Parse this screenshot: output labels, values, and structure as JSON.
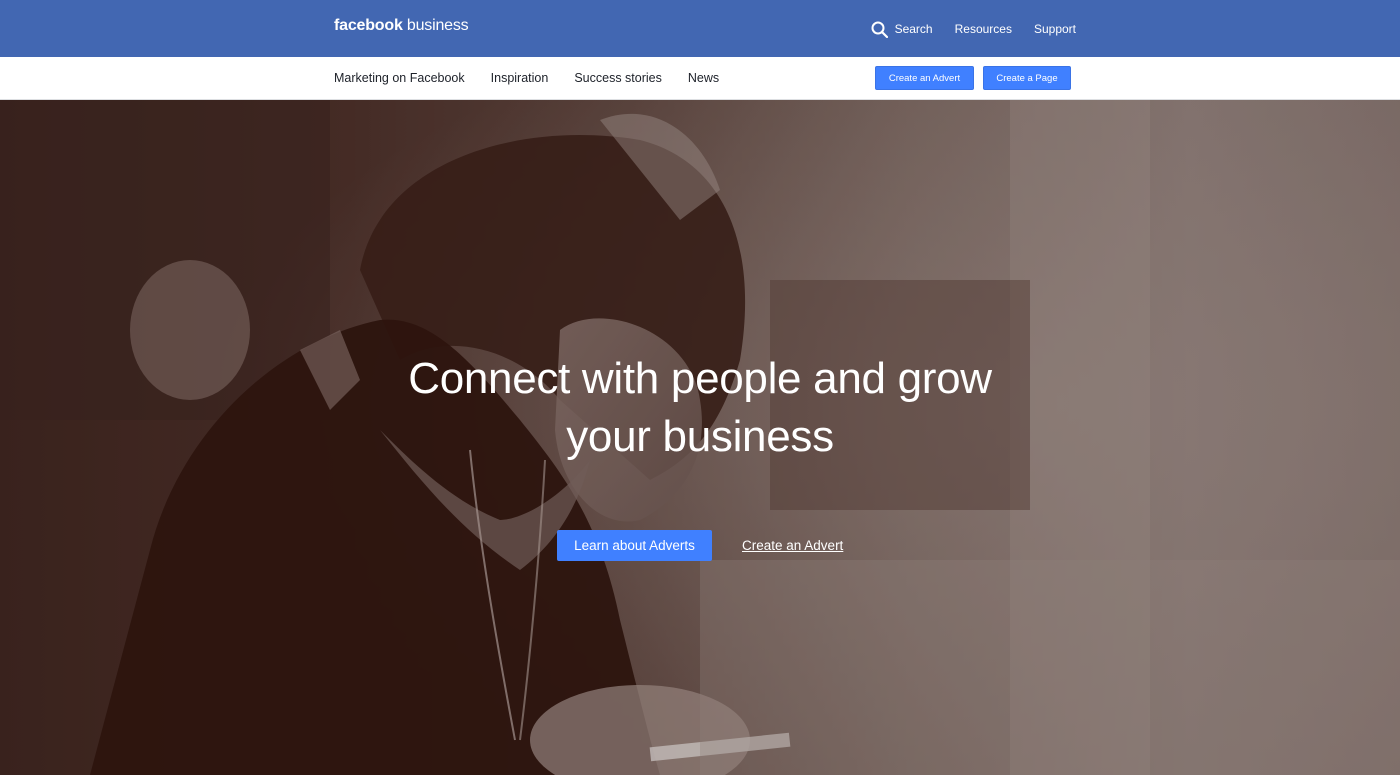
{
  "header": {
    "logo_brand": "facebook",
    "logo_suffix": " business",
    "search_label": "Search",
    "resources_label": "Resources",
    "support_label": "Support",
    "search_icon": "search-icon",
    "background_color": "#4267b2"
  },
  "subnav": {
    "items": [
      {
        "label": "Marketing on Facebook"
      },
      {
        "label": "Inspiration"
      },
      {
        "label": "Success stories"
      },
      {
        "label": "News"
      }
    ],
    "create_advert_label": "Create an Advert",
    "create_page_label": "Create a Page",
    "button_color": "#4080ff"
  },
  "hero": {
    "title_line1": "Connect with people and grow",
    "title_line2": "your business",
    "primary_cta": "Learn about Adverts",
    "secondary_cta": "Create an Advert"
  }
}
